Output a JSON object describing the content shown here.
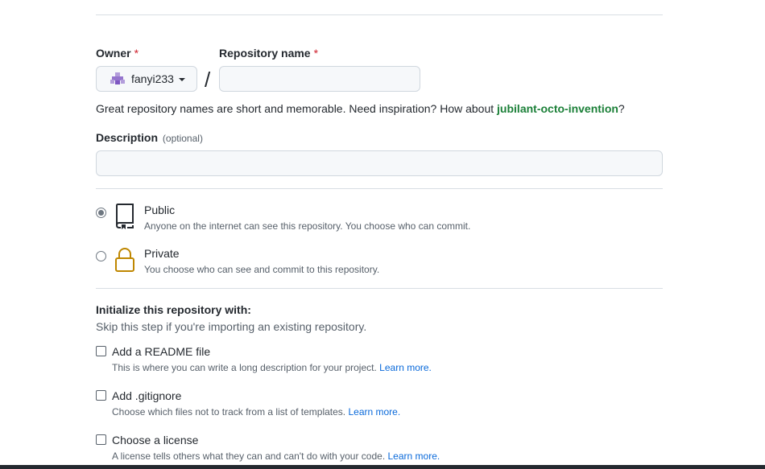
{
  "owner": {
    "label": "Owner",
    "required_mark": "*",
    "value": "fanyi233"
  },
  "repository": {
    "label": "Repository name",
    "required_mark": "*",
    "value": "",
    "separator": "/"
  },
  "name_hint": {
    "text_before": "Great repository names are short and memorable. Need inspiration? How about ",
    "suggestion": "jubilant-octo-invention",
    "text_after": "?"
  },
  "description": {
    "label": "Description",
    "optional": "(optional)",
    "value": ""
  },
  "visibility": {
    "selected": "public",
    "public": {
      "title": "Public",
      "description": "Anyone on the internet can see this repository. You choose who can commit."
    },
    "private": {
      "title": "Private",
      "description": "You choose who can see and commit to this repository."
    }
  },
  "initialize": {
    "heading": "Initialize this repository with:",
    "subtext": "Skip this step if you're importing an existing repository.",
    "options": [
      {
        "title": "Add a README file",
        "description": "This is where you can write a long description for your project.",
        "link": "Learn more.",
        "checked": false
      },
      {
        "title": "Add .gitignore",
        "description": "Choose which files not to track from a list of templates.",
        "link": "Learn more.",
        "checked": false
      },
      {
        "title": "Choose a license",
        "description": "A license tells others what they can and can't do with your code.",
        "link": "Learn more.",
        "checked": false
      }
    ]
  },
  "colors": {
    "accent_link": "#0969da",
    "suggestion_green": "#1a7f37",
    "required_red": "#cf222e",
    "private_lock": "#bf8700"
  }
}
